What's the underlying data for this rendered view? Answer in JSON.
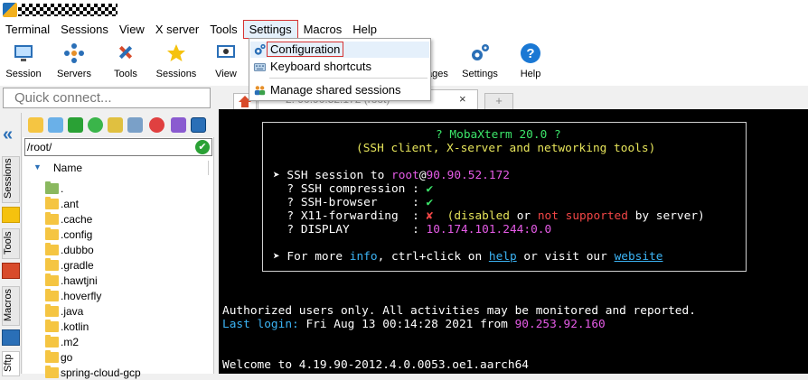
{
  "menubar": {
    "items": [
      "Terminal",
      "Sessions",
      "View",
      "X server",
      "Tools",
      "Settings",
      "Macros",
      "Help"
    ]
  },
  "toolbar": {
    "buttons": [
      "Session",
      "Servers",
      "Tools",
      "Sessions",
      "View",
      "ages",
      "Settings",
      "Help"
    ]
  },
  "quick_connect": {
    "placeholder": "Quick connect..."
  },
  "side_tabs": [
    "Sessions",
    "Tools",
    "Macros",
    "Sftp"
  ],
  "sftp": {
    "path": "/root/",
    "column_name": "Name",
    "files": [
      ".",
      ".ant",
      ".cache",
      ".config",
      ".dubbo",
      ".gradle",
      ".hawtjni",
      ".hoverfly",
      ".java",
      ".kotlin",
      ".m2",
      "go",
      "spring-cloud-gcp"
    ]
  },
  "tabs": {
    "session_label": "2. 90.90.52.172 (root)",
    "close_glyph": "×",
    "new_tab_glyph": "+"
  },
  "settings_menu": {
    "items": [
      {
        "label": "Configuration",
        "icon": "gear-icon"
      },
      {
        "label": "Keyboard shortcuts",
        "icon": "keyboard-icon"
      },
      {
        "label": "Manage shared sessions",
        "icon": "users-icon"
      }
    ]
  },
  "terminal": {
    "title": "? MobaXterm 20.0 ?",
    "subtitle": "(SSH client, X-server and networking tools)",
    "ssh_prefix": "➤ SSH session to ",
    "ssh_user": "root",
    "ssh_at": "@",
    "ssh_host": "90.90.52.172",
    "compression_label": "  ? SSH compression : ",
    "browser_label": "  ? SSH-browser     : ",
    "x11_label": "  ? X11-forwarding  : ",
    "check_mark": "✔",
    "cross_mark": "✘",
    "x11_open": "  (",
    "x11_disabled": "disabled",
    "x11_or": " or ",
    "x11_not": "not supported",
    "x11_tail": " by server)",
    "display_label": "  ? DISPLAY         : ",
    "display_value": "10.174.101.244:0.0",
    "info_prefix": "➤ For more ",
    "info_word": "info",
    "info_mid": ", ctrl+click on ",
    "help_word": "help",
    "info_mid2": " or visit our ",
    "website_word": "website",
    "authorized": "Authorized users only. All activities may be monitored and reported.",
    "last_login_label": "Last login: ",
    "last_login_date": "Fri Aug 13 00:14:28 2021",
    "last_login_from": " from ",
    "last_login_ip": "90.253.92.160",
    "welcome": "Welcome to 4.19.90-2012.4.0.0053.oe1.aarch64"
  },
  "colors": {
    "accent_red": "#d63333",
    "terminal_bg": "#000000",
    "folder": "#f5c542"
  }
}
